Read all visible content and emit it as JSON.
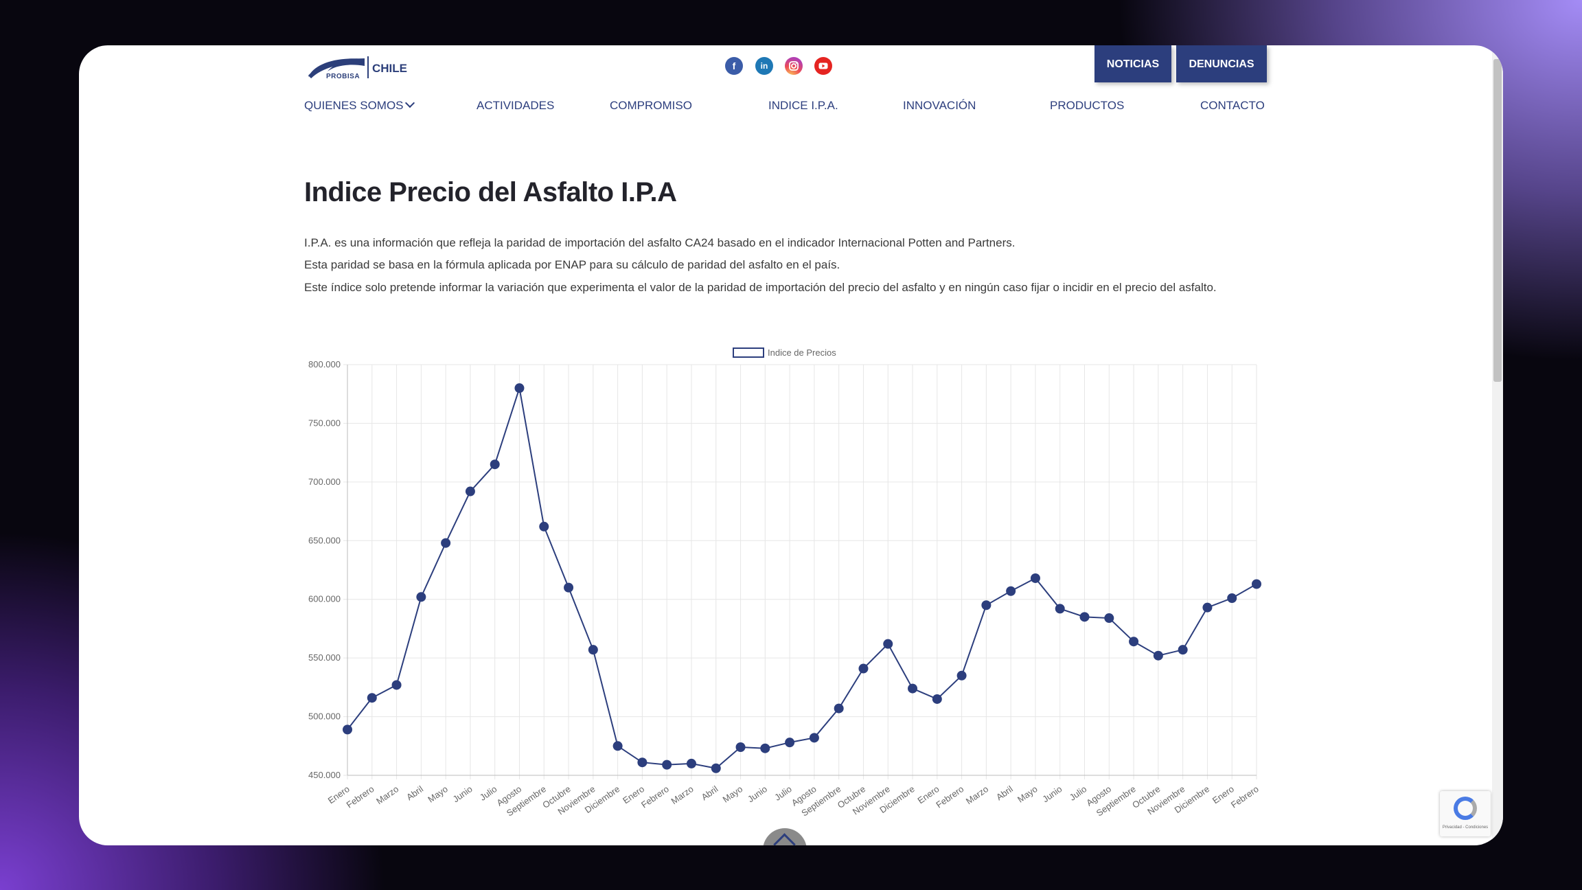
{
  "header": {
    "logo_probisa": "PROBISA",
    "logo_chile": "CHILE",
    "social_icons": [
      "facebook-icon",
      "linkedin-icon",
      "instagram-icon",
      "youtube-icon"
    ],
    "btn_noticias": "NOTICIAS",
    "btn_denuncias": "DENUNCIAS"
  },
  "nav": {
    "items": [
      {
        "label": "QUIENES SOMOS"
      },
      {
        "label": "ACTIVIDADES"
      },
      {
        "label": "COMPROMISO"
      },
      {
        "label": "INDICE I.P.A."
      },
      {
        "label": "INNOVACIÓN"
      },
      {
        "label": "PRODUCTOS"
      },
      {
        "label": "CONTACTO"
      }
    ]
  },
  "main": {
    "title": "Indice Precio del Asfalto I.P.A",
    "paragraphs": [
      "I.P.A. es una información que refleja la paridad de importación del asfalto CA24 basado en el indicador Internacional Potten and Partners.",
      "Esta paridad se basa en la fórmula aplicada por ENAP para su cálculo de paridad del asfalto en el país.",
      "Este índice solo pretende informar la variación que experimenta el valor de la paridad de importación del precio del asfalto y en ningún caso fijar o incidir en el precio del asfalto."
    ]
  },
  "colors": {
    "brand": "#2c3e7d",
    "line": "#2c3e7d",
    "grid": "#e6e6e6"
  },
  "chart_data": {
    "type": "line",
    "categories": [
      "Enero",
      "Febrero",
      "Marzo",
      "Abril",
      "Mayo",
      "Junio",
      "Julio",
      "Agosto",
      "Septiembre",
      "Octubre",
      "Noviembre",
      "Diciembre",
      "Enero",
      "Febrero",
      "Marzo",
      "Abril",
      "Mayo",
      "Junio",
      "Julio",
      "Agosto",
      "Septiembre",
      "Octubre",
      "Noviembre",
      "Diciembre",
      "Enero",
      "Febrero",
      "Marzo",
      "Abril",
      "Mayo",
      "Junio",
      "Julio",
      "Agosto",
      "Septiembre",
      "Octubre",
      "Noviembre",
      "Diciembre",
      "Enero",
      "Febrero"
    ],
    "series": [
      {
        "name": "Indice de Precios",
        "values": [
          489000,
          516000,
          527000,
          602000,
          648000,
          692000,
          715000,
          780000,
          662000,
          610000,
          557000,
          475000,
          461000,
          459000,
          460000,
          456000,
          474000,
          473000,
          478000,
          482000,
          507000,
          541000,
          562000,
          524000,
          515000,
          535000,
          595000,
          607000,
          618000,
          592000,
          585000,
          584000,
          564000,
          552000,
          557000,
          593000,
          601000,
          613000
        ]
      }
    ],
    "yticks": [
      "800.000",
      "750.000",
      "700.000",
      "650.000",
      "600.000",
      "550.000",
      "500.000",
      "450.000"
    ],
    "ylim": [
      450000,
      800000
    ],
    "legend": "top-center",
    "grid": true
  },
  "widgets": {
    "recaptcha_text": "Privacidad - Condiciones"
  }
}
